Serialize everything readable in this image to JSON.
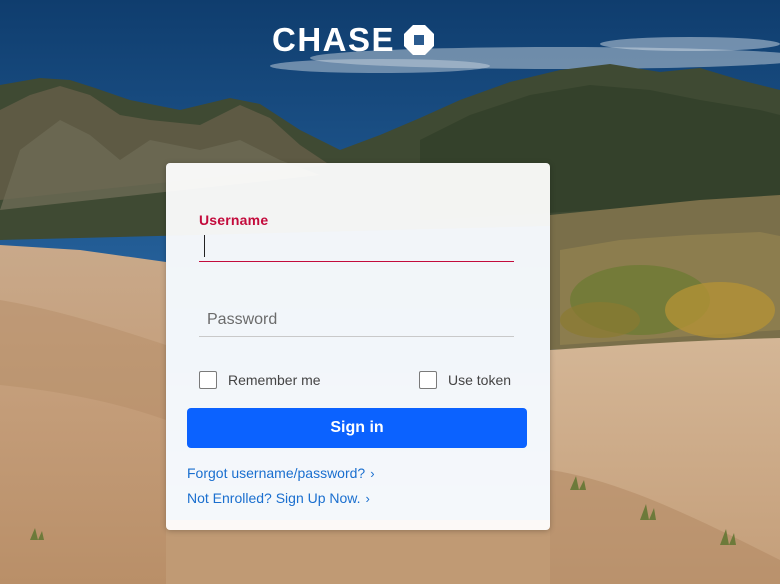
{
  "brand": {
    "name": "CHASE",
    "logo_icon": "chase-octagon-icon"
  },
  "login": {
    "username_label": "Username",
    "username_value": "",
    "password_placeholder": "Password",
    "remember_label": "Remember me",
    "token_label": "Use token",
    "signin_label": "Sign in",
    "forgot_link": "Forgot username/password?",
    "enroll_link": "Not Enrolled? Sign Up Now.",
    "link_chevron": "›"
  },
  "colors": {
    "brand_blue": "#0b62ff",
    "error_red": "#c30b3c",
    "link_blue": "#1a6fcf",
    "card_bg": "#ffffff"
  }
}
